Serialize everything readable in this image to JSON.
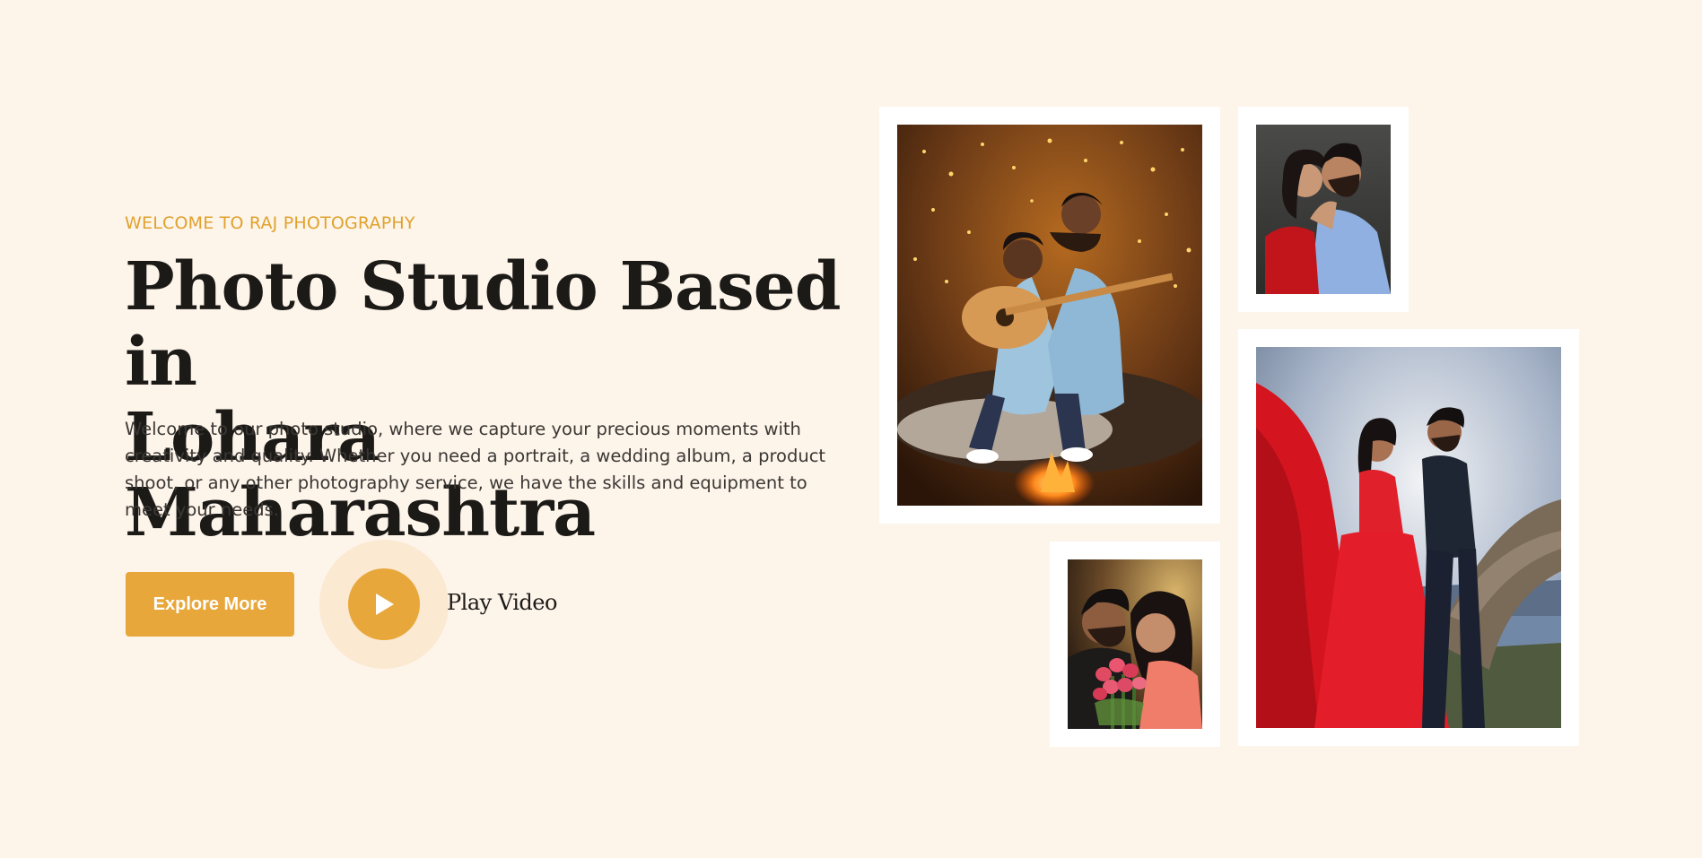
{
  "hero": {
    "subtitle": "WELCOME TO RAJ PHOTOGRAPHY",
    "title_line1": "Photo Studio Based in",
    "title_line2": "Lohara Maharashtra",
    "description": "Welcome to our photo studio, where we capture your precious moments with creativity and quality. Whether you need a portrait, a wedding album, a product shoot, or any other photography service, we have the skills and equipment to meet your needs.",
    "explore_button": "Explore More",
    "play_video_label": "Play Video"
  },
  "colors": {
    "background": "#fdf4ea",
    "accent": "#e8a73a",
    "subtitle": "#e0a22e",
    "heading": "#1c1a17",
    "body_text": "#3a3734",
    "play_halo": "#fbe9d2"
  },
  "icons": {
    "play": "play-icon"
  },
  "gallery": [
    {
      "name": "couple-guitar-campfire-photo"
    },
    {
      "name": "couple-embrace-photo"
    },
    {
      "name": "couple-red-gown-photo"
    },
    {
      "name": "couple-roses-photo"
    }
  ]
}
